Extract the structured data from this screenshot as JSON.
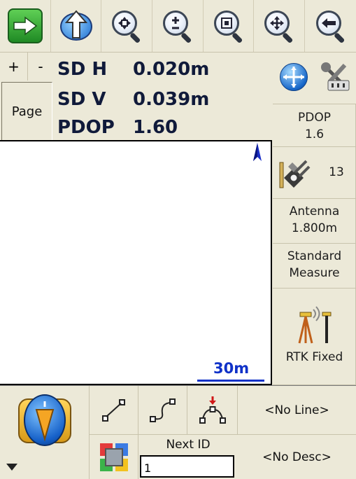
{
  "toolbar": {
    "buttons": [
      {
        "name": "next-arrow-button",
        "icon": "right-arrow-icon"
      },
      {
        "name": "north-up-button",
        "icon": "globe-arrow-icon"
      },
      {
        "name": "zoom-extents-button",
        "icon": "zoom-extents-icon"
      },
      {
        "name": "zoom-in-out-button",
        "icon": "zoom-plus-minus-icon"
      },
      {
        "name": "zoom-window-button",
        "icon": "zoom-window-icon"
      },
      {
        "name": "pan-button",
        "icon": "pan-icon"
      },
      {
        "name": "back-button",
        "icon": "back-arrow-icon"
      }
    ]
  },
  "page_controls": {
    "plus": "+",
    "minus": "-",
    "page": "Page"
  },
  "stats": [
    {
      "label": "SD H",
      "value": "0.020m"
    },
    {
      "label": "SD V",
      "value": "0.039m"
    },
    {
      "label": "PDOP",
      "value": "1.60"
    }
  ],
  "status_panel": {
    "pdop_label": "PDOP",
    "pdop_value": "1.6",
    "satellites": "13",
    "antenna_label": "Antenna",
    "antenna_value": "1.800m",
    "measure_line1": "Standard",
    "measure_line2": "Measure",
    "solution": "RTK Fixed"
  },
  "map": {
    "scale": "30m",
    "north": "north-arrow-icon"
  },
  "bottom": {
    "line_value": "<No Line>",
    "desc_value": "<No Desc>",
    "next_id_label": "Next ID",
    "next_id_value": "1"
  },
  "colors": {
    "accent_green": "#3aa63a",
    "navy": "#101a3a",
    "scale_blue": "#1032c8",
    "background": "#ece9d8"
  }
}
